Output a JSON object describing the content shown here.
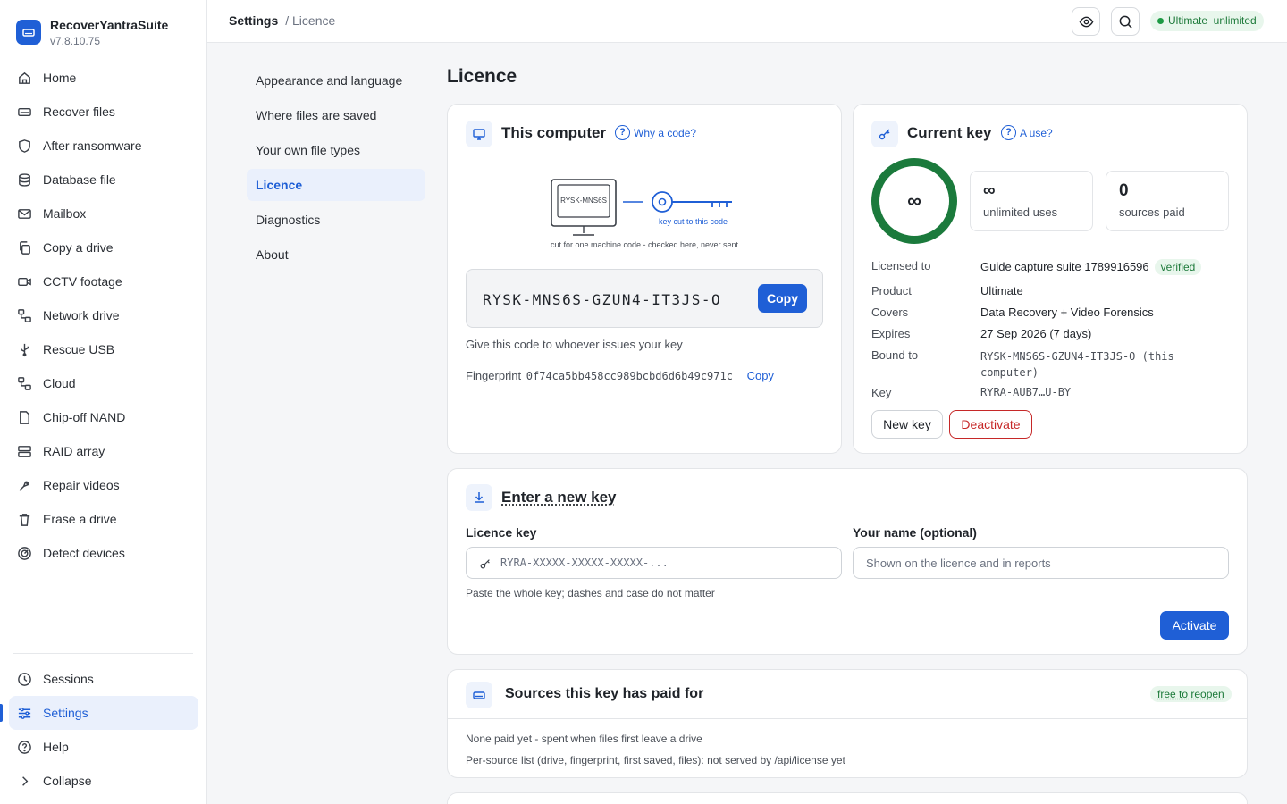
{
  "app": {
    "name": "RecoverYantraSuite",
    "version": "v7.8.10.75"
  },
  "nav": {
    "items": [
      {
        "label": "Home",
        "icon": "home-icon"
      },
      {
        "label": "Recover files",
        "icon": "drive-icon"
      },
      {
        "label": "After ransomware",
        "icon": "shield-icon"
      },
      {
        "label": "Database file",
        "icon": "database-icon"
      },
      {
        "label": "Mailbox",
        "icon": "mail-icon"
      },
      {
        "label": "Copy a drive",
        "icon": "copy-icon"
      },
      {
        "label": "CCTV footage",
        "icon": "camera-icon"
      },
      {
        "label": "Network drive",
        "icon": "network-icon"
      },
      {
        "label": "Rescue USB",
        "icon": "usb-icon"
      },
      {
        "label": "Cloud",
        "icon": "cloud-icon"
      },
      {
        "label": "Chip-off NAND",
        "icon": "chip-icon"
      },
      {
        "label": "RAID array",
        "icon": "raid-icon"
      },
      {
        "label": "Repair videos",
        "icon": "repair-icon"
      },
      {
        "label": "Erase a drive",
        "icon": "trash-icon"
      },
      {
        "label": "Detect devices",
        "icon": "detect-icon"
      }
    ],
    "bottom": [
      {
        "label": "Sessions",
        "icon": "clock-icon"
      },
      {
        "label": "Settings",
        "icon": "sliders-icon"
      },
      {
        "label": "Help",
        "icon": "help-icon"
      },
      {
        "label": "Collapse",
        "icon": "chevron-right-icon"
      }
    ]
  },
  "topbar": {
    "breadcrumb_root": "Settings",
    "breadcrumb_current": "/ Licence",
    "plan_badge": "Ultimate  unlimited"
  },
  "settings_menu": [
    "Appearance and language",
    "Where files are saved",
    "Your own file types",
    "Licence",
    "Diagnostics",
    "About"
  ],
  "page_title": "Licence",
  "this_computer": {
    "title": "This computer",
    "help": "Why a code?",
    "monitor_label": "RYSK-MNS6S",
    "key_label": "key cut to this code",
    "caption": "cut for one machine code - checked here, never sent",
    "code": "RYSK-MNS6S-GZUN4-IT3JS-O",
    "copy_label": "Copy",
    "hint": "Give this code to whoever issues your key",
    "fingerprint_label": "Fingerprint",
    "fingerprint": "0f74ca5bb458cc989bcbd6d6b49c971c",
    "fingerprint_copy": "Copy"
  },
  "current_key": {
    "title": "Current key",
    "help": "A use?",
    "ring_value": "∞",
    "stats": [
      {
        "value": "∞",
        "label": "unlimited uses"
      },
      {
        "value": "0",
        "label": "sources paid"
      }
    ],
    "details": {
      "licensed_to_label": "Licensed to",
      "licensed_to": "Guide capture suite 1789916596",
      "verified": "verified",
      "product_label": "Product",
      "product": "Ultimate",
      "covers_label": "Covers",
      "covers": "Data Recovery + Video Forensics",
      "expires_label": "Expires",
      "expires": "27 Sep 2026 (7 days)",
      "bound_label": "Bound to",
      "bound_line1": "RYSK-MNS6S-GZUN4-IT3JS-O (this",
      "bound_line2": "computer)",
      "key_label": "Key",
      "key": "RYRA-AUB7…U-BY"
    },
    "new_key_label": "New key",
    "deactivate_label": "Deactivate"
  },
  "enter_key": {
    "title": "Enter a new key",
    "licence_label": "Licence key",
    "licence_placeholder": "RYRA-XXXXX-XXXXX-XXXXX-...",
    "name_label": "Your name (optional)",
    "name_placeholder": "Shown on the licence and in reports",
    "hint": "Paste the whole key; dashes and case do not matter",
    "activate_label": "Activate"
  },
  "sources": {
    "title": "Sources this key has paid for",
    "badge": "free to reopen",
    "line1": "None paid yet - spent when files first leave a drive",
    "line2": "Per-source list (drive, fingerprint, first saved, files): not served by /api/license yet"
  },
  "colors": {
    "accent": "#1f5fd6",
    "success": "#1b7a3c",
    "danger": "#c62828"
  }
}
